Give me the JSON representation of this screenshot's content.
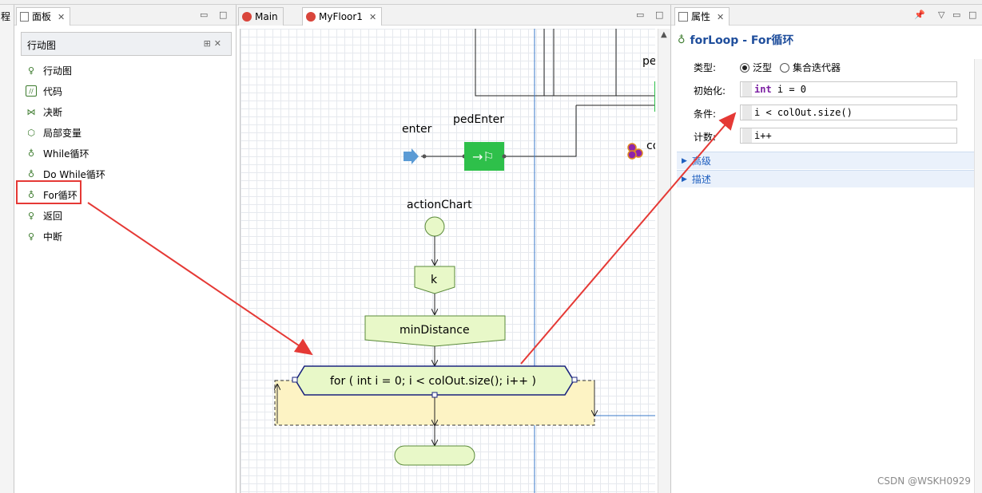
{
  "left_partial_tab": "程",
  "palette": {
    "tab_label": "面板",
    "group_title": "行动图",
    "items": [
      {
        "label": "行动图",
        "icon": "action-chart-icon"
      },
      {
        "label": "代码",
        "icon": "code-icon"
      },
      {
        "label": "决断",
        "icon": "decision-icon"
      },
      {
        "label": "局部变量",
        "icon": "local-variable-icon"
      },
      {
        "label": "While循环",
        "icon": "while-loop-icon"
      },
      {
        "label": "Do While循环",
        "icon": "do-while-loop-icon"
      },
      {
        "label": "For循环",
        "icon": "for-loop-icon"
      },
      {
        "label": "返回",
        "icon": "return-icon"
      },
      {
        "label": "中断",
        "icon": "break-icon"
      }
    ]
  },
  "editor": {
    "tabs": [
      {
        "label": "Main",
        "active": false
      },
      {
        "label": "MyFloor1",
        "active": true
      }
    ],
    "diagram": {
      "labels": {
        "pe_partial": "pe",
        "enter": "enter",
        "ped_enter": "pedEnter",
        "co_partial": "co",
        "action_chart": "actionChart",
        "k": "k",
        "min_distance": "minDistance",
        "for_loop": "for ( int i = 0; i < colOut.size(); i++ )"
      }
    }
  },
  "properties": {
    "tab_label": "属性",
    "title": "forLoop - For循环",
    "type_label": "类型:",
    "type_options": [
      {
        "label": "泛型",
        "selected": true
      },
      {
        "label": "集合迭代器",
        "selected": false
      }
    ],
    "init_label": "初始化:",
    "init_keyword": "int",
    "init_value": " i = 0",
    "condition_label": "条件:",
    "condition_value": "i < colOut.size()",
    "count_label": "计数:",
    "count_value": "i++",
    "sections": [
      {
        "label": "高级"
      },
      {
        "label": "描述"
      }
    ]
  },
  "watermark": "CSDN @WSKH0929",
  "colors": {
    "highlight_red": "#e53935",
    "node_green_fill": "#e8f8c8",
    "node_green_stroke": "#5a8a3a",
    "for_node_stroke": "#1a237e",
    "loop_body_fill": "#fdf3c4",
    "ped_enter_green": "#2ec04a",
    "blue_line": "#3a78c8"
  }
}
